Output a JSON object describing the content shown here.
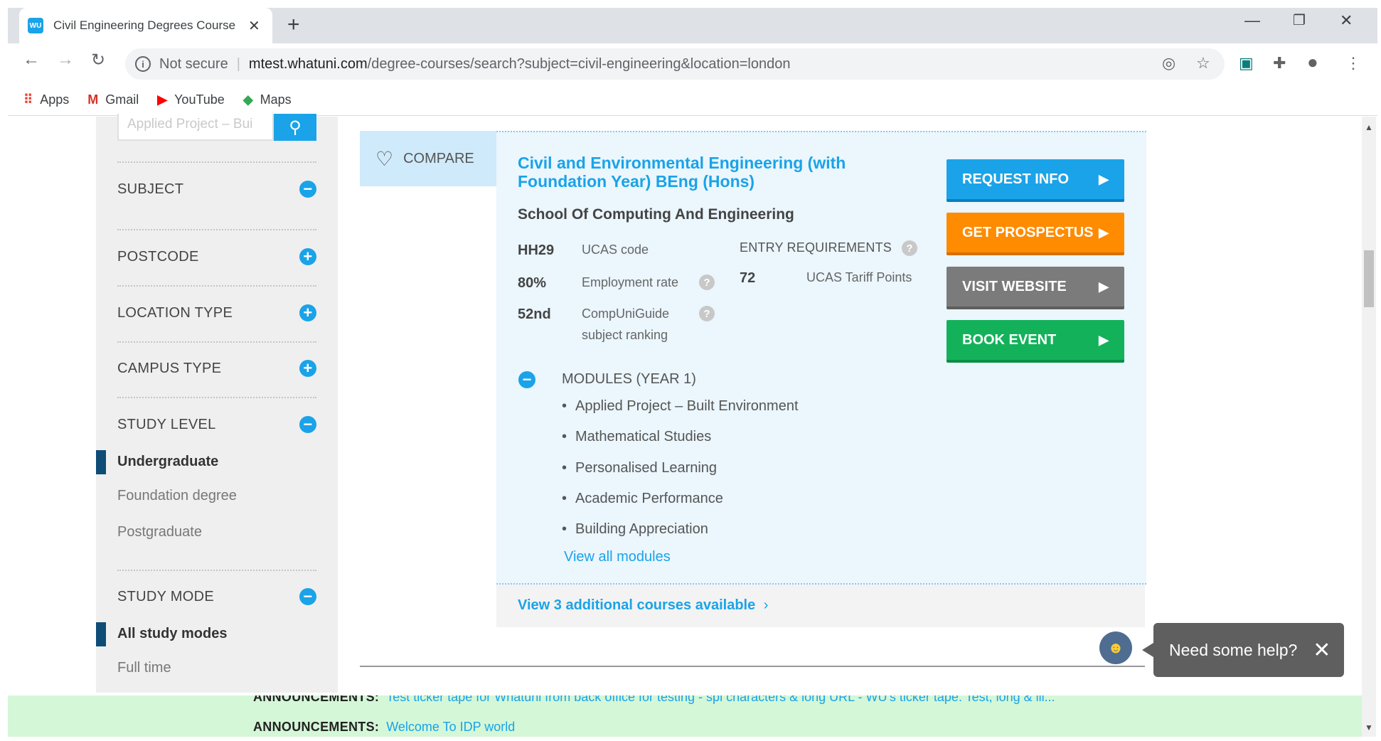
{
  "browser": {
    "tab_title": "Civil Engineering Degrees Course",
    "tab_favicon_text": "WU",
    "omnibox": {
      "security_label": "Not secure",
      "host": "mtest.whatuni.com",
      "path": "/degree-courses/search?subject=civil-engineering&location=london"
    },
    "bookmarks": [
      "Apps",
      "Gmail",
      "YouTube",
      "Maps"
    ]
  },
  "sidebar": {
    "search_placeholder": "Applied Project – Bui",
    "filters": [
      {
        "label": "SUBJECT",
        "state": "minus"
      },
      {
        "label": "POSTCODE",
        "state": "plus"
      },
      {
        "label": "LOCATION TYPE",
        "state": "plus"
      },
      {
        "label": "CAMPUS TYPE",
        "state": "plus"
      },
      {
        "label": "STUDY LEVEL",
        "state": "minus"
      },
      {
        "label": "STUDY MODE",
        "state": "minus"
      }
    ],
    "study_level_options": [
      "Undergraduate",
      "Foundation degree",
      "Postgraduate"
    ],
    "study_mode_options": [
      "All study modes",
      "Full time"
    ]
  },
  "course": {
    "compare_label": "COMPARE",
    "title": "Civil and Environmental Engineering (with Foundation Year) BEng (Hons)",
    "school": "School Of Computing And Engineering",
    "stats": {
      "ucas_code": "HH29",
      "ucas_code_label": "UCAS code",
      "employment_rate": "80%",
      "employment_rate_label": "Employment rate",
      "ranking": "52nd",
      "ranking_label": "CompUniGuide subject ranking"
    },
    "entry": {
      "heading": "ENTRY REQUIREMENTS",
      "value": "72",
      "label": "UCAS Tariff Points"
    },
    "buttons": {
      "request_info": "REQUEST INFO",
      "get_prospectus": "GET PROSPECTUS",
      "visit_website": "VISIT WEBSITE",
      "book_event": "BOOK EVENT"
    },
    "modules": {
      "heading": "MODULES (YEAR 1)",
      "items": [
        "Applied Project – Built Environment",
        "Mathematical Studies",
        "Personalised Learning",
        "Academic Performance",
        "Building Appreciation"
      ],
      "view_all": "View all modules"
    },
    "additional_courses": "View 3 additional courses available"
  },
  "help": {
    "label": "Need some help?"
  },
  "announcements": {
    "heading": "ANNOUNCEMENTS:",
    "line1": "Test ticker tape for Whatuni from back office for testing - spl characters & long URL - WU's ticker tape. Test, long & lll...",
    "line2": "Welcome To IDP world"
  },
  "colors": {
    "accent": "#1aa3e8",
    "orange": "#ff8b00",
    "grey_button": "#7b7b7b",
    "green": "#13b25a",
    "selected_bar": "#0e4c77",
    "announce_bg": "#d4f7d7"
  }
}
